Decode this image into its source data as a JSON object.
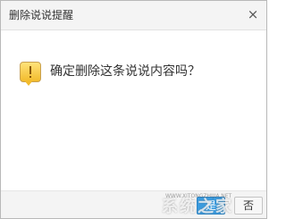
{
  "dialog": {
    "title": "删除说说提醒",
    "close_icon": "close-icon",
    "close_glyph": "×",
    "message": "确定删除这条说说内容吗？",
    "icon": "warning-icon"
  },
  "buttons": {
    "yes_label": "是",
    "no_label": "否"
  },
  "watermark": {
    "text": "系统之家",
    "url": "WWW.XITONGZHIJIA.NET"
  },
  "colors": {
    "accent": "#3a9ce0",
    "warning": "#f2bb2c"
  }
}
